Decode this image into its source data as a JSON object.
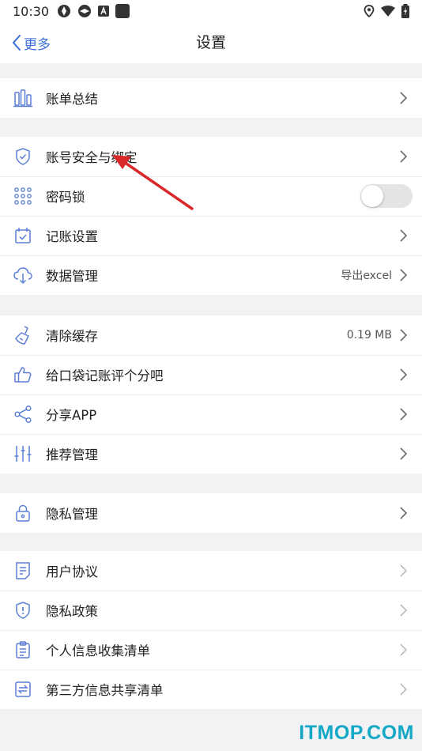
{
  "status_bar": {
    "time": "10:30"
  },
  "nav": {
    "back_label": "更多",
    "title": "设置"
  },
  "groups": [
    {
      "items": [
        {
          "icon": "bar-chart-icon",
          "label": "账单总结",
          "action": "chevron"
        }
      ]
    },
    {
      "items": [
        {
          "icon": "shield-check-icon",
          "label": "账号安全与绑定",
          "action": "chevron"
        },
        {
          "icon": "keypad-icon",
          "label": "密码锁",
          "action": "toggle",
          "toggle_on": false
        },
        {
          "icon": "calendar-check-icon",
          "label": "记账设置",
          "action": "chevron"
        },
        {
          "icon": "cloud-download-icon",
          "label": "数据管理",
          "value": "导出excel",
          "action": "chevron"
        }
      ]
    },
    {
      "items": [
        {
          "icon": "broom-icon",
          "label": "清除缓存",
          "value": "0.19 MB",
          "action": "chevron"
        },
        {
          "icon": "thumbs-up-icon",
          "label": "给口袋记账评个分吧",
          "action": "chevron"
        },
        {
          "icon": "share-icon",
          "label": "分享APP",
          "action": "chevron"
        },
        {
          "icon": "sliders-icon",
          "label": "推荐管理",
          "action": "chevron"
        }
      ]
    },
    {
      "items": [
        {
          "icon": "lock-icon",
          "label": "隐私管理",
          "action": "chevron"
        }
      ]
    },
    {
      "items": [
        {
          "icon": "document-icon",
          "label": "用户协议",
          "action": "chevron-light"
        },
        {
          "icon": "shield-alert-icon",
          "label": "隐私政策",
          "action": "chevron-light"
        },
        {
          "icon": "clipboard-list-icon",
          "label": "个人信息收集清单",
          "action": "chevron-light"
        },
        {
          "icon": "exchange-icon",
          "label": "第三方信息共享清单",
          "action": "chevron-light"
        }
      ]
    }
  ],
  "watermark": "ITMOP.COM",
  "colors": {
    "accent": "#3a6fd8",
    "icon": "#5b7fd6",
    "annotation_arrow": "#d8282a",
    "watermark": "#14a8c7"
  }
}
